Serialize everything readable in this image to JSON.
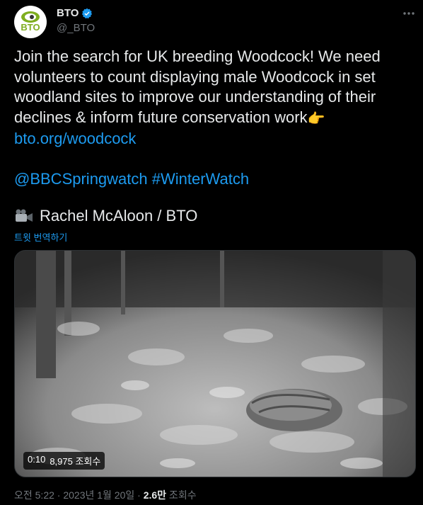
{
  "account": {
    "display_name": "BTO",
    "handle": "@_BTO",
    "avatar_text": "BTO"
  },
  "tweet": {
    "lines": [
      "Join the search for UK breeding Woodcock! We need",
      "volunteers to count displaying male Woodcock in set",
      "woodland sites to improve our understanding of their",
      "declines & inform future conservation work"
    ],
    "emoji": "👉",
    "link": "bto.org/woodcock",
    "hashtags_line": "@BBCSpringwatch #WinterWatch",
    "credit": "Rachel McAloon / BTO",
    "translate_label": "트윗 번역하기"
  },
  "media": {
    "time": "0:10",
    "views": "8,975 조회수"
  },
  "meta": {
    "time_date": "오전 5:22 · 2023년 1월 20일 · ",
    "views_count": "2.6만",
    "views_label": " 조회수"
  },
  "colors": {
    "background": "#000000",
    "text": "#e7e9ea",
    "muted": "#71767b",
    "link": "#1d9bf0",
    "brand_green": "#7fae1f"
  }
}
